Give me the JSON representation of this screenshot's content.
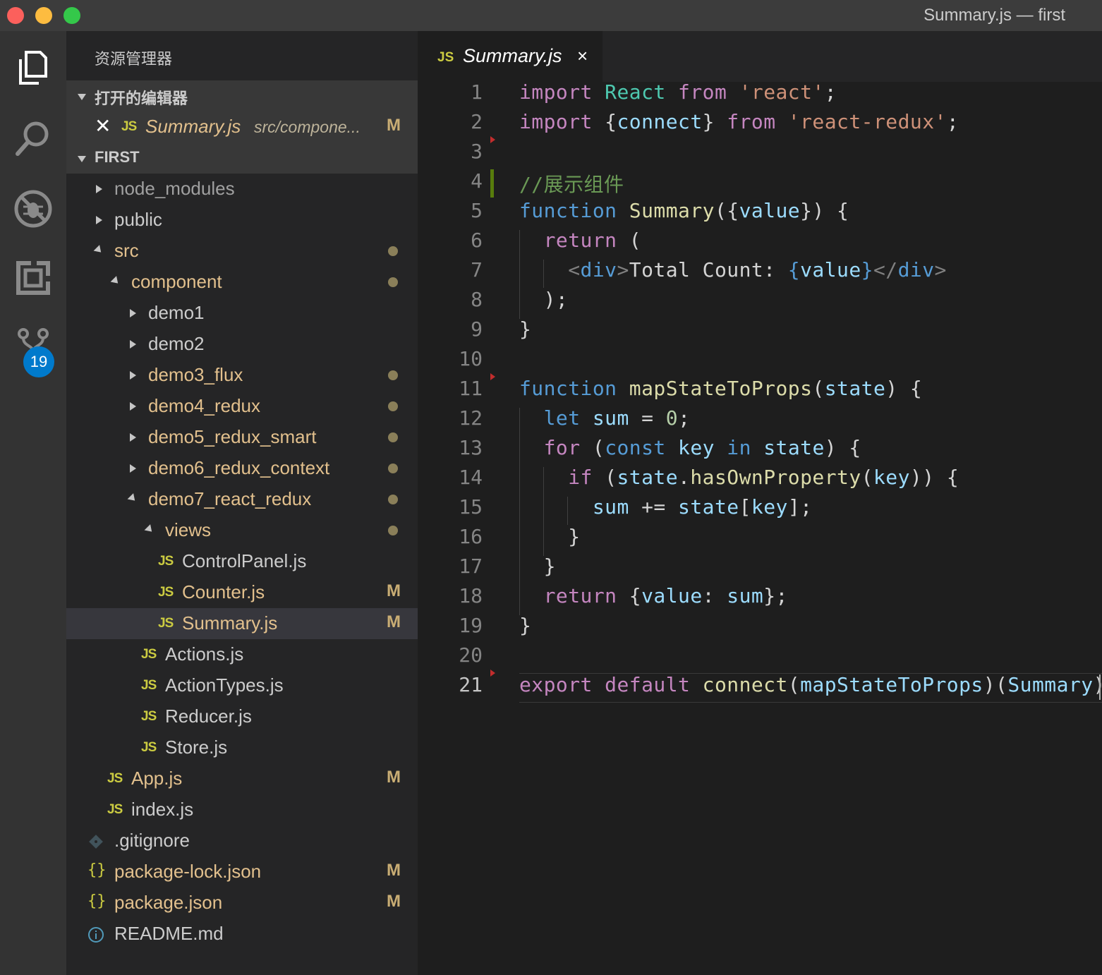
{
  "window": {
    "title": "Summary.js — first"
  },
  "activity": {
    "scm_badge": "19"
  },
  "sidebar": {
    "header": "资源管理器",
    "open_editors_label": "打开的编辑器",
    "open_editor": {
      "file": "Summary.js",
      "path": "src/compone...",
      "status": "M"
    },
    "project_label": "FIRST",
    "tree": [
      {
        "label": "node_modules",
        "status": ""
      },
      {
        "label": "public",
        "status": ""
      },
      {
        "label": "src",
        "status": ""
      },
      {
        "label": "component",
        "status": ""
      },
      {
        "label": "demo1",
        "status": ""
      },
      {
        "label": "demo2",
        "status": ""
      },
      {
        "label": "demo3_flux",
        "status": ""
      },
      {
        "label": "demo4_redux",
        "status": ""
      },
      {
        "label": "demo5_redux_smart",
        "status": ""
      },
      {
        "label": "demo6_redux_context",
        "status": ""
      },
      {
        "label": "demo7_react_redux",
        "status": ""
      },
      {
        "label": "views",
        "status": ""
      },
      {
        "label": "ControlPanel.js",
        "status": ""
      },
      {
        "label": "Counter.js",
        "status": "M"
      },
      {
        "label": "Summary.js",
        "status": "M"
      },
      {
        "label": "Actions.js",
        "status": ""
      },
      {
        "label": "ActionTypes.js",
        "status": ""
      },
      {
        "label": "Reducer.js",
        "status": ""
      },
      {
        "label": "Store.js",
        "status": ""
      },
      {
        "label": "App.js",
        "status": "M"
      },
      {
        "label": "index.js",
        "status": ""
      },
      {
        "label": ".gitignore",
        "status": ""
      },
      {
        "label": "package-lock.json",
        "status": "M"
      },
      {
        "label": "package.json",
        "status": "M"
      },
      {
        "label": "README.md",
        "status": ""
      }
    ]
  },
  "icons": {
    "js": "JS",
    "json": "{}"
  },
  "tab": {
    "name": "Summary.js",
    "close": "×"
  },
  "editor": {
    "lines": [
      [
        [
          "k",
          "import"
        ],
        [
          "p",
          " "
        ],
        [
          "t",
          "React"
        ],
        [
          "p",
          " "
        ],
        [
          "k",
          "from"
        ],
        [
          "p",
          " "
        ],
        [
          "s",
          "'react'"
        ],
        [
          "p",
          ";"
        ]
      ],
      [
        [
          "k",
          "import"
        ],
        [
          "p",
          " "
        ],
        [
          "p",
          "{"
        ],
        [
          "v",
          "connect"
        ],
        [
          "p",
          "}"
        ],
        [
          "p",
          " "
        ],
        [
          "k",
          "from"
        ],
        [
          "p",
          " "
        ],
        [
          "s",
          "'react-redux'"
        ],
        [
          "p",
          ";"
        ]
      ],
      [],
      [
        [
          "c",
          "//展示组件"
        ]
      ],
      [
        [
          "b",
          "function"
        ],
        [
          "p",
          " "
        ],
        [
          "f",
          "Summary"
        ],
        [
          "p",
          "({"
        ],
        [
          "v",
          "value"
        ],
        [
          "p",
          "}) {"
        ]
      ],
      [
        [
          "p",
          "  "
        ],
        [
          "k",
          "return"
        ],
        [
          "p",
          " ("
        ]
      ],
      [
        [
          "p",
          "    "
        ],
        [
          "tg",
          "<"
        ],
        [
          "tn",
          "div"
        ],
        [
          "tg",
          ">"
        ],
        [
          "p",
          "Total Count: "
        ],
        [
          "b",
          "{"
        ],
        [
          "v",
          "value"
        ],
        [
          "b",
          "}"
        ],
        [
          "tg",
          "</"
        ],
        [
          "tn",
          "div"
        ],
        [
          "tg",
          ">"
        ]
      ],
      [
        [
          "p",
          "  );"
        ]
      ],
      [
        [
          "p",
          "}"
        ]
      ],
      [],
      [
        [
          "b",
          "function"
        ],
        [
          "p",
          " "
        ],
        [
          "f",
          "mapStateToProps"
        ],
        [
          "p",
          "("
        ],
        [
          "v",
          "state"
        ],
        [
          "p",
          ") {"
        ]
      ],
      [
        [
          "p",
          "  "
        ],
        [
          "b",
          "let"
        ],
        [
          "p",
          " "
        ],
        [
          "v",
          "sum"
        ],
        [
          "p",
          " = "
        ],
        [
          "n",
          "0"
        ],
        [
          "p",
          ";"
        ]
      ],
      [
        [
          "p",
          "  "
        ],
        [
          "k",
          "for"
        ],
        [
          "p",
          " ("
        ],
        [
          "b",
          "const"
        ],
        [
          "p",
          " "
        ],
        [
          "v",
          "key"
        ],
        [
          "p",
          " "
        ],
        [
          "b",
          "in"
        ],
        [
          "p",
          " "
        ],
        [
          "v",
          "state"
        ],
        [
          "p",
          ") {"
        ]
      ],
      [
        [
          "p",
          "    "
        ],
        [
          "k",
          "if"
        ],
        [
          "p",
          " ("
        ],
        [
          "v",
          "state"
        ],
        [
          "p",
          "."
        ],
        [
          "f",
          "hasOwnProperty"
        ],
        [
          "p",
          "("
        ],
        [
          "v",
          "key"
        ],
        [
          "p",
          ")) {"
        ]
      ],
      [
        [
          "p",
          "      "
        ],
        [
          "v",
          "sum"
        ],
        [
          "p",
          " += "
        ],
        [
          "v",
          "state"
        ],
        [
          "p",
          "["
        ],
        [
          "v",
          "key"
        ],
        [
          "p",
          "];"
        ]
      ],
      [
        [
          "p",
          "    }"
        ]
      ],
      [
        [
          "p",
          "  }"
        ]
      ],
      [
        [
          "p",
          "  "
        ],
        [
          "k",
          "return"
        ],
        [
          "p",
          " {"
        ],
        [
          "v",
          "value"
        ],
        [
          "p",
          ": "
        ],
        [
          "v",
          "sum"
        ],
        [
          "p",
          "};"
        ]
      ],
      [
        [
          "p",
          "}"
        ]
      ],
      [],
      [
        [
          "k",
          "export"
        ],
        [
          "p",
          " "
        ],
        [
          "k",
          "default"
        ],
        [
          "p",
          " "
        ],
        [
          "f",
          "connect"
        ],
        [
          "p",
          "("
        ],
        [
          "v",
          "mapStateToProps"
        ],
        [
          "p",
          ")("
        ],
        [
          "v",
          "Summary"
        ],
        [
          "p",
          ");"
        ]
      ]
    ]
  }
}
